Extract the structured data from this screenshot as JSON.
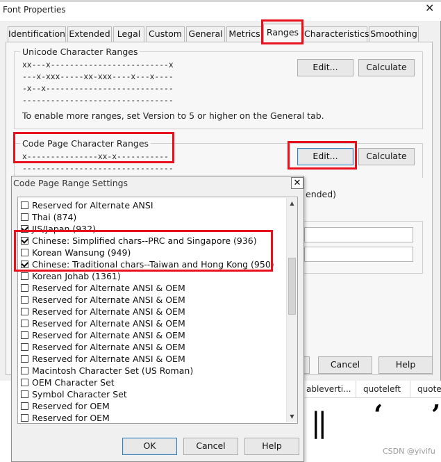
{
  "window": {
    "title": "Font Properties",
    "close_glyph": "✕"
  },
  "tabs": [
    {
      "label": "Identification"
    },
    {
      "label": "Extended"
    },
    {
      "label": "Legal"
    },
    {
      "label": "Custom"
    },
    {
      "label": "General"
    },
    {
      "label": "Metrics"
    },
    {
      "label": "Ranges",
      "active": true
    },
    {
      "label": "Characteristics"
    },
    {
      "label": "Smoothing"
    }
  ],
  "unicode_group": {
    "title": "Unicode Character Ranges",
    "lines": [
      "xx---x-------------------------x",
      "---x-xxx-----xx-xxx----x---x----",
      "-x--x---------------------------",
      "--------------------------------"
    ],
    "note": "To enable more ranges, set Version to 5 or higher on the General tab.",
    "edit_label": "Edit...",
    "calculate_label": "Calculate"
  },
  "codepage_group": {
    "title": "Code Page Character Ranges",
    "lines": [
      "x---------------xx-x-----------",
      "--------------------------------"
    ],
    "edit_label": "Edit...",
    "calculate_label": "Calculate"
  },
  "behind": {
    "partial_text": "ended)",
    "cancel_label": "Cancel",
    "help_label": "Help"
  },
  "glyph_columns": [
    {
      "label": "ableverti..."
    },
    {
      "label": "quoteleft"
    },
    {
      "label": "quoter"
    }
  ],
  "glyphs": {
    "g1": "||",
    "g2": "‘",
    "g3": "’"
  },
  "watermark": "CSDN @yivifu",
  "dialog": {
    "title": "Code Page Range Settings",
    "close_glyph": "✕",
    "items": [
      {
        "label": "Reserved for Alternate ANSI",
        "checked": false
      },
      {
        "label": "Thai (874)",
        "checked": false
      },
      {
        "label": "JIS/Japan (932)",
        "checked": true
      },
      {
        "label": "Chinese: Simplified chars--PRC and Singapore (936)",
        "checked": true
      },
      {
        "label": "Korean Wansung (949)",
        "checked": false
      },
      {
        "label": "Chinese: Traditional chars--Taiwan and Hong Kong (950)",
        "checked": true
      },
      {
        "label": "Korean Johab (1361)",
        "checked": false
      },
      {
        "label": "Reserved for Alternate ANSI & OEM",
        "checked": false
      },
      {
        "label": "Reserved for Alternate ANSI & OEM",
        "checked": false
      },
      {
        "label": "Reserved for Alternate ANSI & OEM",
        "checked": false
      },
      {
        "label": "Reserved for Alternate ANSI & OEM",
        "checked": false
      },
      {
        "label": "Reserved for Alternate ANSI & OEM",
        "checked": false
      },
      {
        "label": "Reserved for Alternate ANSI & OEM",
        "checked": false
      },
      {
        "label": "Reserved for Alternate ANSI & OEM",
        "checked": false
      },
      {
        "label": "Macintosh Character Set (US Roman)",
        "checked": false
      },
      {
        "label": "OEM Character Set",
        "checked": false
      },
      {
        "label": "Symbol Character Set",
        "checked": false
      },
      {
        "label": "Reserved for OEM",
        "checked": false
      },
      {
        "label": "Reserved for OEM",
        "checked": false
      }
    ],
    "ok_label": "OK",
    "cancel_label": "Cancel",
    "help_label": "Help"
  },
  "colors": {
    "highlight_box": "#e8101c",
    "window_bg": "#f0f0f0"
  }
}
